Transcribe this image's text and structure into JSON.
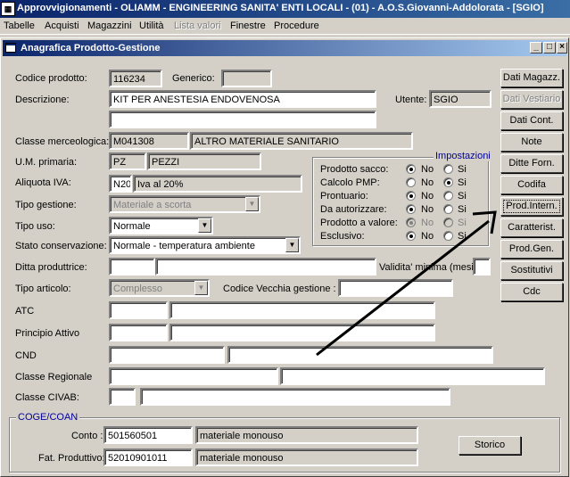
{
  "window": {
    "title": "Approvvigionamenti - OLIAMM  - ENGINEERING SANITA' ENTI LOCALI - (01) - A.O.S.Giovanni-Addolorata - [SGIO]"
  },
  "menu": {
    "items": [
      "Tabelle",
      "Acquisti",
      "Magazzini",
      "Utilità",
      "Lista valori",
      "Finestre",
      "Procedure"
    ]
  },
  "form": {
    "title": "Anagrafica Prodotto-Gestione",
    "labels": {
      "codice_prodotto": "Codice prodotto:",
      "generico": "Generico:",
      "descrizione": "Descrizione:",
      "utente": "Utente:",
      "classe_merceologica": "Classe merceologica:",
      "um_primaria": "U.M. primaria:",
      "aliquota_iva": "Aliquota IVA:",
      "tipo_gestione": "Tipo gestione:",
      "tipo_uso": "Tipo uso:",
      "stato_conservazione": "Stato conservazione:",
      "ditta_produttrice": "Ditta produttrice:",
      "validita_minima": "Validita' minima (mesi):",
      "tipo_articolo": "Tipo articolo:",
      "codice_vecchia_gestione": "Codice Vecchia gestione :",
      "atc": "ATC",
      "principio_attivo": "Principio Attivo",
      "cnd": "CND",
      "classe_regionale": "Classe Regionale",
      "classe_civab": "Classe CIVAB:"
    },
    "values": {
      "codice_prodotto": "116234",
      "generico": "",
      "descrizione": "KIT PER ANESTESIA ENDOVENOSA",
      "descrizione2": "",
      "utente": "SGIO",
      "classe_code": "M041308",
      "classe_desc": "ALTRO MATERIALE SANITARIO",
      "um_code": "PZ",
      "um_desc": "PEZZI",
      "iva_code": "N20",
      "iva_desc": "Iva al 20%",
      "tipo_gestione": "Materiale a scorta",
      "tipo_uso": "Normale",
      "stato_conservazione": "Normale - temperatura ambiente",
      "tipo_articolo": "Complesso"
    }
  },
  "impostazioni": {
    "title": "Impostazioni",
    "no_label": "No",
    "si_label": "Si",
    "rows": [
      {
        "label": "Prodotto sacco:",
        "value": "No",
        "disabled": false
      },
      {
        "label": "Calcolo PMP:",
        "value": "Si",
        "disabled": false
      },
      {
        "label": "Prontuario:",
        "value": "No",
        "disabled": false
      },
      {
        "label": "Da autorizzare:",
        "value": "No",
        "disabled": false
      },
      {
        "label": "Prodotto a valore:",
        "value": "No",
        "disabled": true
      },
      {
        "label": "Esclusivo:",
        "value": "No",
        "disabled": false
      }
    ]
  },
  "side_buttons": [
    {
      "label": "Dati Magazz.",
      "disabled": false
    },
    {
      "label": "Dati Vestiario",
      "disabled": true
    },
    {
      "label": "Dati Cont.",
      "disabled": false
    },
    {
      "label": "Note",
      "disabled": false
    },
    {
      "label": "Ditte Forn.",
      "disabled": false
    },
    {
      "label": "Codifa",
      "disabled": false
    },
    {
      "label": "Prod.Intern.",
      "disabled": false
    },
    {
      "label": "Caratterist.",
      "disabled": false
    },
    {
      "label": "Prod.Gen.",
      "disabled": false
    },
    {
      "label": "Sostitutivi",
      "disabled": false
    },
    {
      "label": "Cdc",
      "disabled": false
    }
  ],
  "coge": {
    "title": "COGE/COAN",
    "conto_label": "Conto :",
    "conto_code": "501560501",
    "conto_desc": "materiale monouso",
    "fat_label": "Fat. Produttivo:",
    "fat_code": "52010901011",
    "fat_desc": "materiale monouso",
    "storico_label": "Storico"
  },
  "colors": {
    "titlebar": "#0a246a",
    "group_title": "#0000a0",
    "face": "#d4d0c8"
  }
}
